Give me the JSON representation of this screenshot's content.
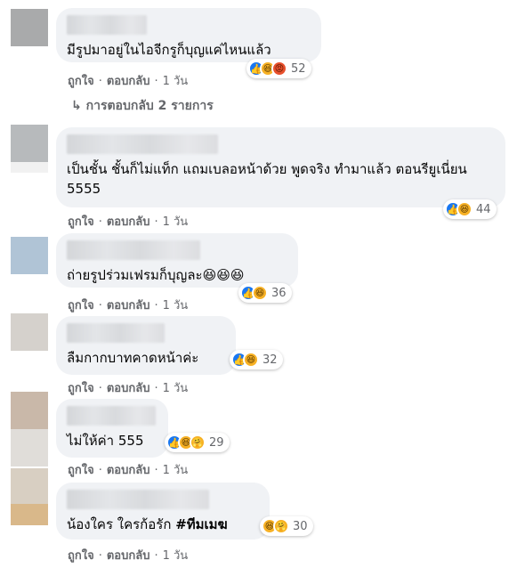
{
  "colors": {
    "like": "#1877f2",
    "haha": "#f7b125",
    "angry": "#e8502d",
    "meta": "#65676b",
    "bubble": "#f0f2f5"
  },
  "comments": [
    {
      "text": "มีรูปมาอยู่ในไอจีกรูก็บุญแค่ไหนแล้ว",
      "reactions": [
        "like-icon",
        "haha-icon",
        "angry-icon"
      ],
      "count": "52",
      "like": "ถูกใจ",
      "reply": "ตอบกลับ",
      "time": "1 วัน"
    },
    {
      "text": "เป็นชั้น ชั้นก็ไม่แท็ก แถมเบลอหน้าด้วย พูดจริง ทำมาแล้ว ตอนรียูเนี่ยน 5555",
      "reactions": [
        "like-icon",
        "haha-icon"
      ],
      "count": "44",
      "like": "ถูกใจ",
      "reply": "ตอบกลับ",
      "time": "1 วัน"
    },
    {
      "text": "ถ่ายรูปร่วมเฟรมก็บุญละ😆😆😆",
      "reactions": [
        "like-icon",
        "haha-icon"
      ],
      "count": "36",
      "like": "ถูกใจ",
      "reply": "ตอบกลับ",
      "time": "1 วัน"
    },
    {
      "text": "ลืมกากบาทคาดหน้าค่ะ",
      "reactions": [
        "like-icon",
        "haha-icon"
      ],
      "count": "32",
      "like": "ถูกใจ",
      "reply": "ตอบกลับ",
      "time": "1 วัน"
    },
    {
      "text": "ไม่ให้ค่า 555",
      "reactions": [
        "like-icon",
        "haha-icon",
        "care-icon"
      ],
      "count": "29",
      "like": "ถูกใจ",
      "reply": "ตอบกลับ",
      "time": "1 วัน"
    },
    {
      "text": "น้องใคร ใครก้อรัก",
      "tag": "#ทีมเมฆ",
      "reactions": [
        "haha-icon",
        "care-icon"
      ],
      "count": "30",
      "like": "ถูกใจ",
      "reply": "ตอบกลับ",
      "time": "1 วัน"
    }
  ],
  "replies_label": "การตอบกลับ 2 รายการ"
}
